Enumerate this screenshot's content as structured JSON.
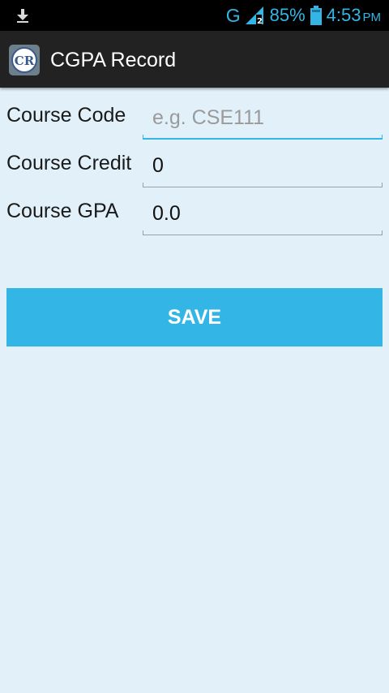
{
  "status_bar": {
    "network": "G",
    "battery": "85%",
    "time": "4:53",
    "ampm": "PM",
    "icons": [
      "download-icon",
      "signal-icon",
      "battery-icon"
    ],
    "accent_color": "#33b5e5"
  },
  "action_bar": {
    "app_icon_text": "CR",
    "title": "CGPA Record"
  },
  "form": {
    "course_code": {
      "label": "Course Code",
      "value": "",
      "placeholder": "e.g. CSE111"
    },
    "course_credit": {
      "label": "Course Credit",
      "value": "0"
    },
    "course_gpa": {
      "label": "Course GPA",
      "value": "0.0"
    }
  },
  "save_label": "SAVE",
  "colors": {
    "background": "#e2f1f9",
    "button": "#33b5e5",
    "action_bar": "#222222"
  }
}
